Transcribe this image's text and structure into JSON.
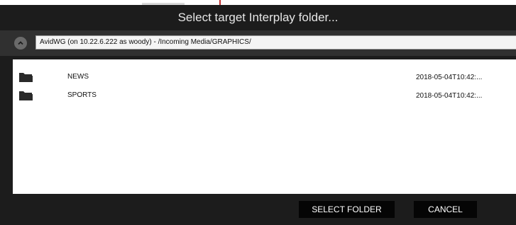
{
  "dialog": {
    "title": "Select target Interplay folder..."
  },
  "path_bar": {
    "collapse_icon": "chevron-up-icon",
    "path_value": "AvidWG (on 10.22.6.222 as woody) - /Incoming Media/GRAPHICS/"
  },
  "folders": [
    {
      "icon": "folder-icon",
      "name": "NEWS",
      "date": "2018-05-04T10:42:..."
    },
    {
      "icon": "folder-icon",
      "name": "SPORTS",
      "date": "2018-05-04T10:42:..."
    }
  ],
  "buttons": {
    "select_label": "SELECT FOLDER",
    "cancel_label": "CANCEL"
  },
  "colors": {
    "dialog_background": "#1c1c1c",
    "path_bar_background": "#303030",
    "list_background": "#ffffff",
    "button_background": "#050505"
  }
}
